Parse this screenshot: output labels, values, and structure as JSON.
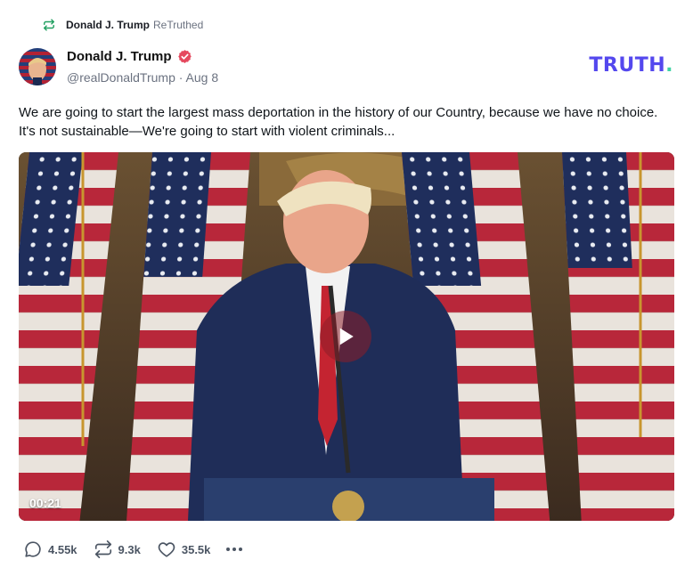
{
  "retruth": {
    "author": "Donald J. Trump",
    "action": "ReTruthed",
    "icon": "retruth-icon",
    "color": "#22a061"
  },
  "post": {
    "display_name": "Donald J. Trump",
    "handle_date": "@realDonaldTrump · Aug 8",
    "verified_icon": "verified-badge-icon",
    "verified_color": "#e5485e",
    "text": "We are going to start the largest mass deportation in the history of our Country, because we have no choice. It's not sustainable—We're going to start with violent criminals..."
  },
  "logo": {
    "text": "TRUTH",
    "dot": ".",
    "color": "#5448ee",
    "dot_color": "#3fd3a4"
  },
  "video": {
    "duration": "00:21",
    "play_icon": "play-icon"
  },
  "actions": {
    "replies": "4.55k",
    "retruths": "9.3k",
    "likes": "35.5k"
  }
}
